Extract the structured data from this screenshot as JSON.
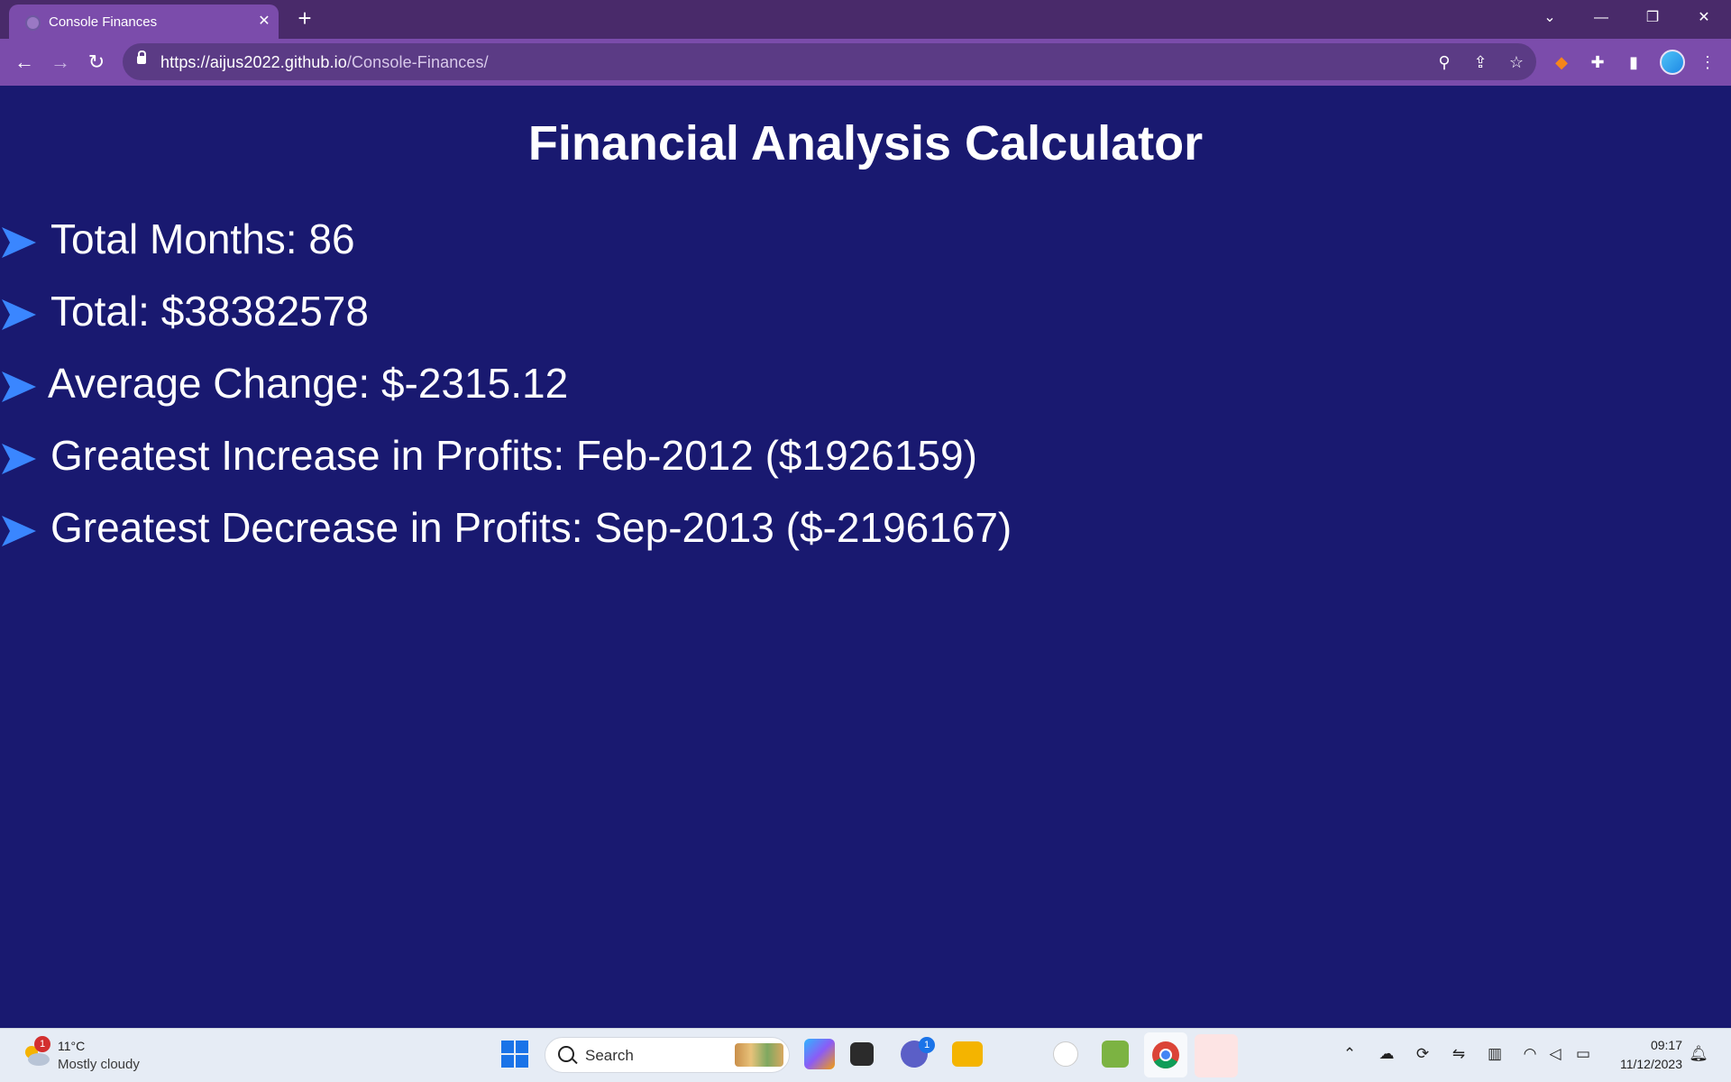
{
  "browser": {
    "tab_title": "Console Finances",
    "url_host": "https://aijus2022.github.io",
    "url_path": "/Console-Finances/",
    "window_controls": {
      "dropdown": "⌄",
      "minimize": "—",
      "restore": "❐",
      "close": "✕"
    }
  },
  "page": {
    "title": "Financial Analysis Calculator",
    "results": [
      "Total Months: 86",
      "Total: $38382578",
      "Average Change: $-2315.12",
      "Greatest Increase in Profits: Feb-2012 ($1926159)",
      "Greatest Decrease in Profits: Sep-2013 ($-2196167)"
    ]
  },
  "colors": {
    "page_background": "#191970",
    "bullet": "#3a86ff",
    "tab_bar": "#492a6a",
    "toolbar": "#7b4cab"
  },
  "taskbar": {
    "weather_temp": "11°C",
    "weather_desc": "Mostly cloudy",
    "weather_badge": "1",
    "search_placeholder": "Search",
    "teams_badge": "1",
    "time": "09:17",
    "date": "11/12/2023"
  }
}
